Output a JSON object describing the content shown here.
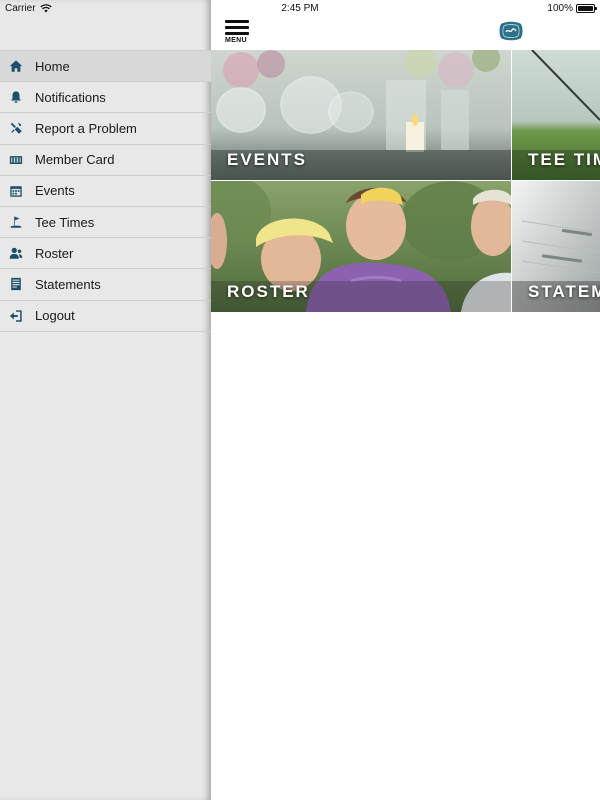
{
  "status_bar": {
    "carrier": "Carrier",
    "time": "2:45 PM",
    "battery": "100%",
    "battery_level": 1.0
  },
  "header": {
    "menu_label": "MENU",
    "logo_icon": "club-crest-logo"
  },
  "sidebar": {
    "items": [
      {
        "label": "Home",
        "icon": "home-icon",
        "active": true
      },
      {
        "label": "Notifications",
        "icon": "bell-icon"
      },
      {
        "label": "Report a Problem",
        "icon": "tools-icon"
      },
      {
        "label": "Member Card",
        "icon": "card-icon"
      },
      {
        "label": "Events",
        "icon": "calendar-icon"
      },
      {
        "label": "Tee Times",
        "icon": "golf-flag-icon"
      },
      {
        "label": "Roster",
        "icon": "people-icon"
      },
      {
        "label": "Statements",
        "icon": "document-icon"
      },
      {
        "label": "Logout",
        "icon": "logout-icon"
      }
    ]
  },
  "tiles": [
    {
      "label": "EVENTS"
    },
    {
      "label": "TEE TIM"
    },
    {
      "label": "ROSTER"
    },
    {
      "label": "STATEM"
    }
  ],
  "colors": {
    "sidebar_bg": "#e8e8e8",
    "icon_color": "#1c4f6b",
    "active_item_bg": "#d8d8d8"
  }
}
